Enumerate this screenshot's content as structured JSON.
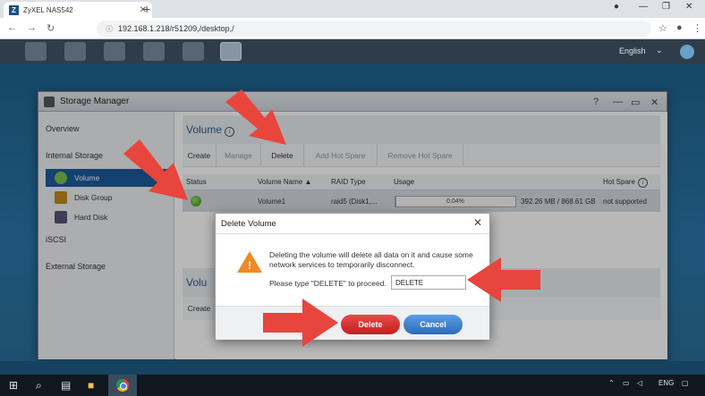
{
  "browser": {
    "tab_title": "ZyXEL NAS542",
    "favicon_letter": "Z",
    "url": "192.168.1.218/r51209,/desktop,/"
  },
  "nas": {
    "language": "English"
  },
  "storage_manager": {
    "window_title": "Storage Manager",
    "sidebar": {
      "overview": "Overview",
      "internal_storage": "Internal Storage",
      "items": [
        {
          "label": "Volume"
        },
        {
          "label": "Disk Group"
        },
        {
          "label": "Hard Disk"
        }
      ],
      "iscsi": "iSCSI",
      "external_storage": "External Storage"
    },
    "volume_title": "Volume",
    "toolbar": {
      "create": "Create",
      "manage": "Manage",
      "delete": "Delete",
      "add_hot_spare": "Add Hot Spare",
      "remove_hot_spare": "Remove Hot Spare"
    },
    "table": {
      "headers": {
        "status": "Status",
        "volume_name": "Volume Name ▲",
        "raid_type": "RAID Type",
        "usage": "Usage",
        "hot_spare": "Hot Spare"
      },
      "rows": [
        {
          "volume_name": "Volume1",
          "raid_type": "raid5 (Disk1,...",
          "usage_percent_text": "0.04%",
          "usage_fraction": 0.0004,
          "capacity": "392.26 MB / 868.61 GB",
          "hot_spare": "not supported"
        }
      ]
    },
    "second_section_title": "Volu",
    "second_toolbar_create": "Create"
  },
  "dialog": {
    "title": "Delete Volume",
    "message": "Deleting the volume will delete all data on it and cause some network services to temporarily disconnect.",
    "prompt": "Please type \"DELETE\" to proceed.",
    "input_value": "DELETE",
    "delete_label": "Delete",
    "cancel_label": "Cancel"
  },
  "taskbar": {
    "lang": "ENG"
  },
  "colors": {
    "accent_blue": "#1c5b9a",
    "delete_red": "#d32f2f",
    "arrow_red": "#e8453c",
    "warning_orange": "#f08a24"
  },
  "icons": [
    "search-icon",
    "gear-icon",
    "close-icon",
    "warning-icon",
    "help-icon",
    "minimize-icon",
    "maximize-icon",
    "chrome-icon",
    "windows-icon"
  ]
}
